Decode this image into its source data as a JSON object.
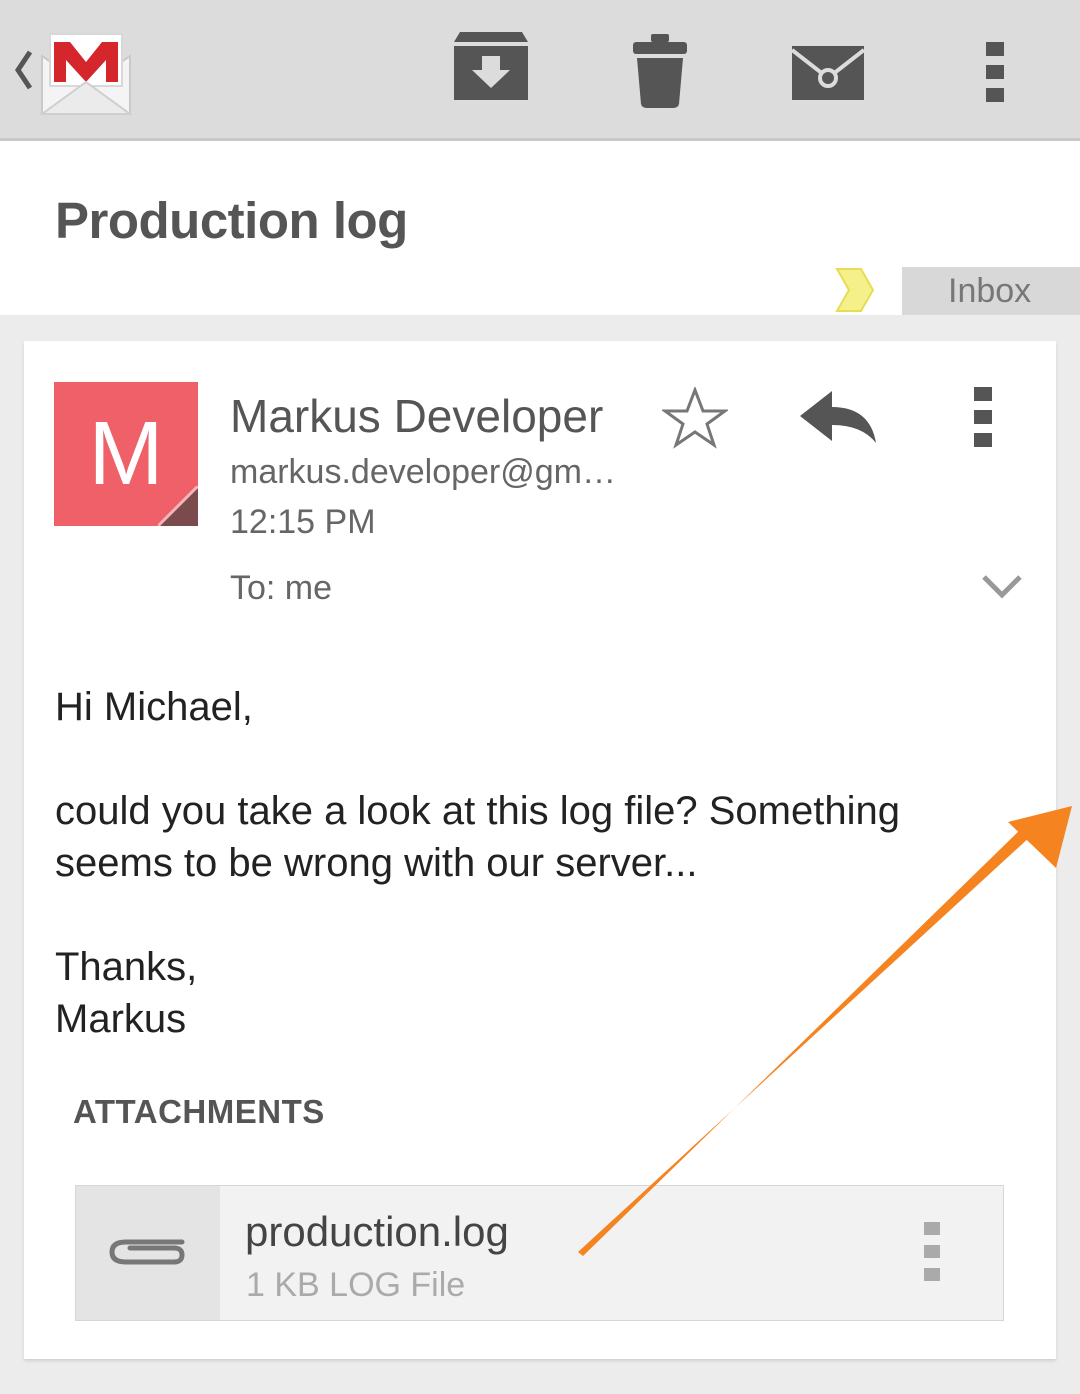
{
  "action_bar": {
    "icons": [
      "up-caret-icon",
      "gmail-logo",
      "archive-icon",
      "delete-icon",
      "mark-unread-icon",
      "overflow-menu-icon"
    ]
  },
  "conversation": {
    "subject": "Production log",
    "label": "Inbox",
    "label_color": "#f5f08a"
  },
  "message": {
    "avatar_letter": "M",
    "avatar_color": "#ef6068",
    "sender_name": "Markus Developer",
    "sender_email": "markus.developer@gm…",
    "time": "12:15 PM",
    "recipients": "To: me",
    "body": {
      "greeting": "Hi Michael,",
      "line1": "could you take a look at this log file? Something",
      "line2": "seems to be wrong with our server...",
      "closing": "Thanks,",
      "signature": "Markus"
    }
  },
  "attachments": {
    "heading": "ATTACHMENTS",
    "items": [
      {
        "name": "production.log",
        "meta": "1 KB LOG File",
        "icon": "paperclip-icon"
      }
    ]
  },
  "annotation": {
    "type": "arrow",
    "color": "#f5831f"
  }
}
